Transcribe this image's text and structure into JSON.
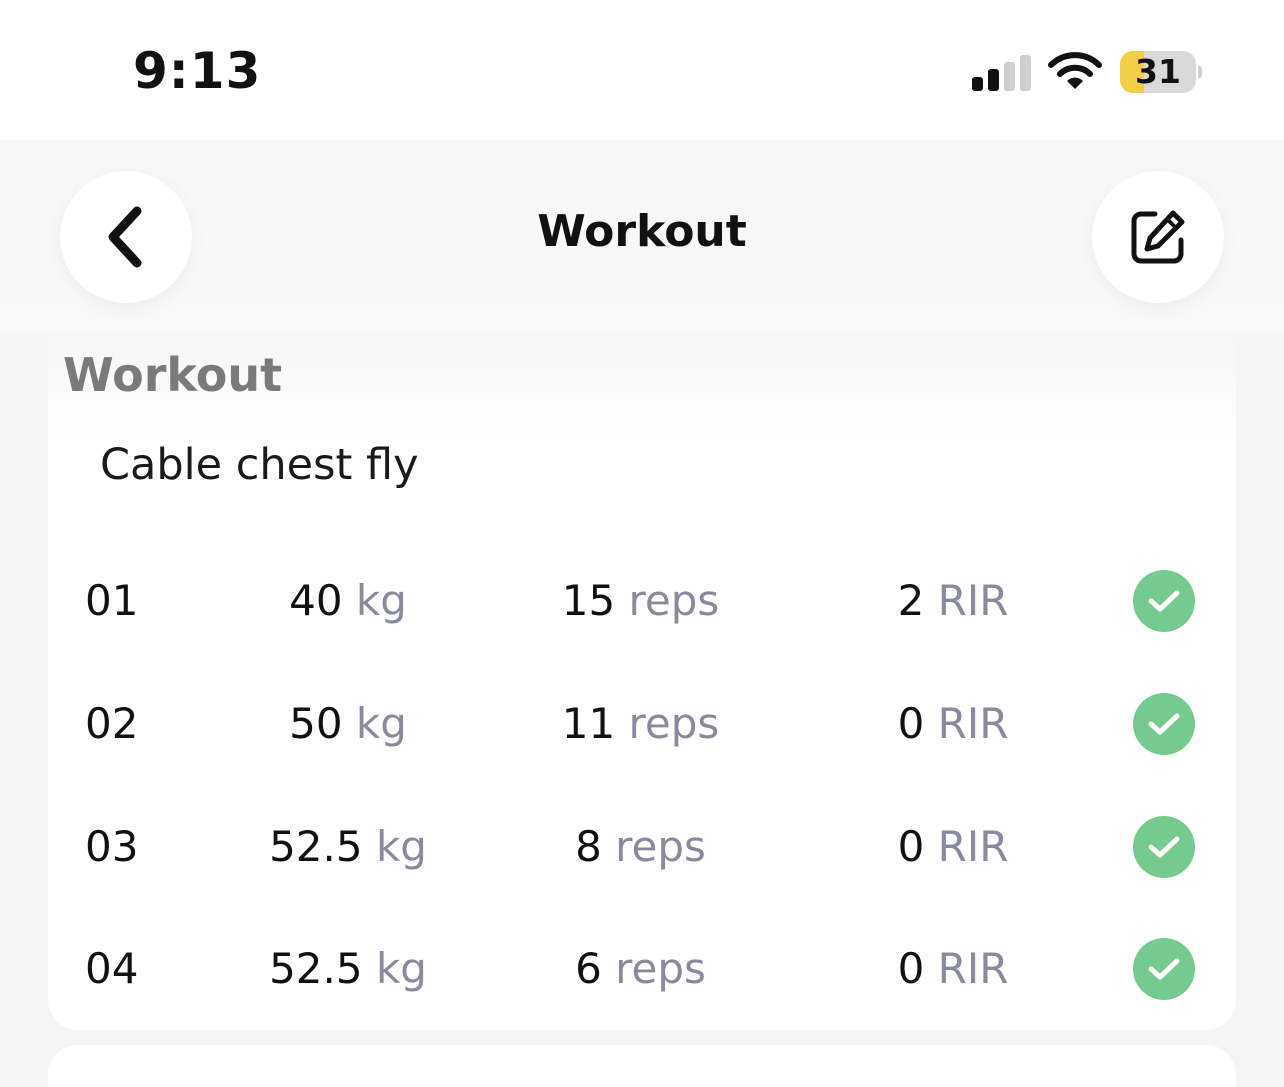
{
  "status_bar": {
    "time": "9:13",
    "battery_level": "31",
    "battery_fraction": 0.31,
    "battery_color": "#f3cf45",
    "signal_bars_active": 2,
    "signal_bars_total": 4
  },
  "nav": {
    "title": "Workout",
    "back_icon": "chevron-left-icon",
    "edit_icon": "edit-square-icon"
  },
  "section": {
    "title": "Workout"
  },
  "exercise": {
    "name": "Cable chest fly",
    "check_color": "#75cb8f",
    "sets": [
      {
        "number": "01",
        "weight": "40",
        "weight_unit": "kg",
        "reps": "15",
        "reps_unit": "reps",
        "rir": "2",
        "rir_unit": "RIR",
        "completed": true
      },
      {
        "number": "02",
        "weight": "50",
        "weight_unit": "kg",
        "reps": "11",
        "reps_unit": "reps",
        "rir": "0",
        "rir_unit": "RIR",
        "completed": true
      },
      {
        "number": "03",
        "weight": "52.5",
        "weight_unit": "kg",
        "reps": "8",
        "reps_unit": "reps",
        "rir": "0",
        "rir_unit": "RIR",
        "completed": true
      },
      {
        "number": "04",
        "weight": "52.5",
        "weight_unit": "kg",
        "reps": "6",
        "reps_unit": "reps",
        "rir": "0",
        "rir_unit": "RIR",
        "completed": true
      }
    ]
  }
}
